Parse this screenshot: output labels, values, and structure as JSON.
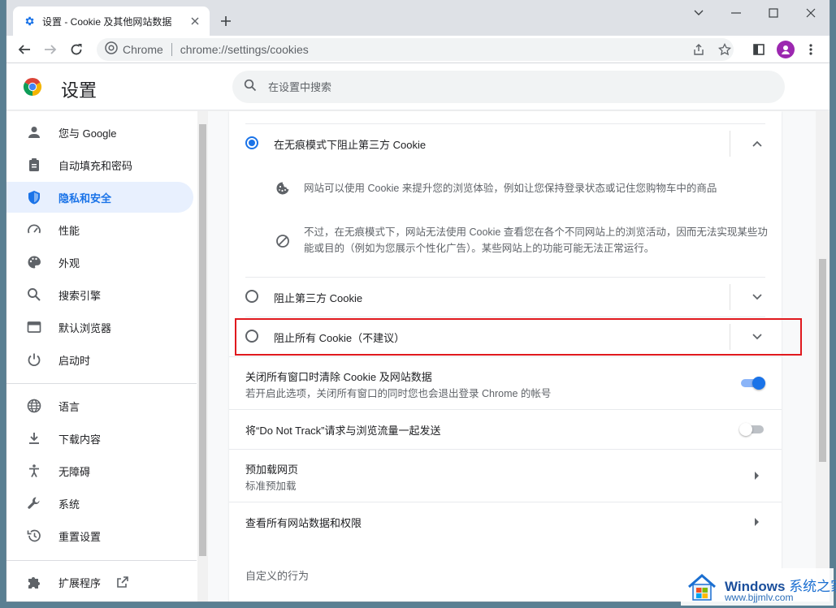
{
  "browser": {
    "tab_title": "设置 - Cookie 及其他网站数据",
    "omnibox_site": "Chrome",
    "omnibox_url": "chrome://settings/cookies"
  },
  "settings": {
    "title": "设置",
    "search_placeholder": "在设置中搜索"
  },
  "sidebar": {
    "items": [
      {
        "label": "您与 Google",
        "icon": "person-icon"
      },
      {
        "label": "自动填充和密码",
        "icon": "clipboard-icon"
      },
      {
        "label": "隐私和安全",
        "icon": "shield-icon",
        "active": true
      },
      {
        "label": "性能",
        "icon": "speedometer-icon"
      },
      {
        "label": "外观",
        "icon": "palette-icon"
      },
      {
        "label": "搜索引擎",
        "icon": "search-icon"
      },
      {
        "label": "默认浏览器",
        "icon": "browser-icon"
      },
      {
        "label": "启动时",
        "icon": "power-icon"
      },
      {
        "label": "语言",
        "icon": "globe-icon"
      },
      {
        "label": "下载内容",
        "icon": "download-icon"
      },
      {
        "label": "无障碍",
        "icon": "accessibility-icon"
      },
      {
        "label": "系统",
        "icon": "wrench-icon"
      },
      {
        "label": "重置设置",
        "icon": "history-icon"
      },
      {
        "label": "扩展程序",
        "icon": "puzzle-icon"
      }
    ]
  },
  "cookies": {
    "options": [
      {
        "label": "在无痕模式下阻止第三方 Cookie",
        "selected": true,
        "expanded": true
      },
      {
        "label": "阻止第三方 Cookie",
        "selected": false
      },
      {
        "label": "阻止所有 Cookie（不建议）",
        "selected": false
      }
    ],
    "details": [
      {
        "icon": "cookie-icon",
        "text": "网站可以使用 Cookie 来提升您的浏览体验，例如让您保持登录状态或记住您购物车中的商品"
      },
      {
        "icon": "block-icon",
        "text": "不过，在无痕模式下，网站无法使用 Cookie 查看您在各个不同网站上的浏览活动，因而无法实现某些功能或目的（例如为您展示个性化广告）。某些网站上的功能可能无法正常运行。"
      }
    ],
    "clear_on_exit": {
      "title": "关闭所有窗口时清除 Cookie 及网站数据",
      "subtitle": "若开启此选项，关闭所有窗口的同时您也会退出登录 Chrome 的帐号",
      "enabled": true
    },
    "do_not_track": {
      "title": "将“Do Not Track”请求与浏览流量一起发送",
      "enabled": false
    },
    "preload": {
      "title": "预加载网页",
      "subtitle": "标准预加载"
    },
    "site_data_link": "查看所有网站数据和权限",
    "custom_section": "自定义的行为"
  },
  "watermark": {
    "brand": "Windows",
    "brand_suffix": "系统之家",
    "url": "www.bjjmlv.com"
  },
  "colors": {
    "accent": "#1a73e8",
    "highlight_box": "#e0191e"
  }
}
